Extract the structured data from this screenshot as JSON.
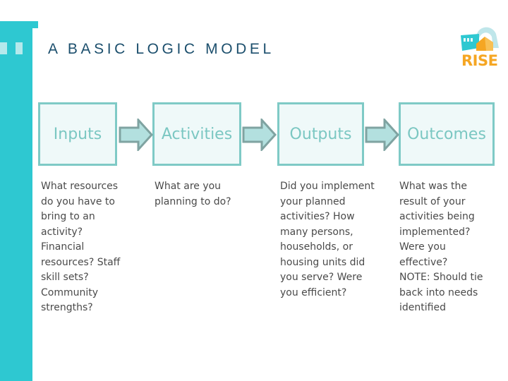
{
  "slide": {
    "title": "A BASIC LOGIC MODEL",
    "logo_text": "RISE",
    "colors": {
      "accent_bar": "#2ec8d1",
      "title": "#1c4f6d",
      "box_border": "#7fcac6",
      "box_fill": "#eff9f9",
      "box_text": "#7bc7c2",
      "arrow_fill": "#b3e0df",
      "arrow_border": "#7fa3a1",
      "logo_orange": "#f5a623",
      "body_text": "#4a4a4a"
    }
  },
  "steps": [
    {
      "label": "Inputs",
      "description": "What resources\ndo you have to\nbring to an\nactivity?\nFinancial\nresources?  Staff\nskill sets?\nCommunity\nstrengths?"
    },
    {
      "label": "Activities",
      "description": "What are you\nplanning to do?"
    },
    {
      "label": "Outputs",
      "description": "Did you implement\nyour planned\nactivities?  How\nmany persons,\nhouseholds, or\nhousing units did\nyou serve?  Were\nyou efficient?"
    },
    {
      "label": "Outcomes",
      "description": "What was the\nresult of your\nactivities being\nimplemented?\nWere you\neffective?\nNOTE: Should tie\nback into needs\nidentified"
    }
  ]
}
